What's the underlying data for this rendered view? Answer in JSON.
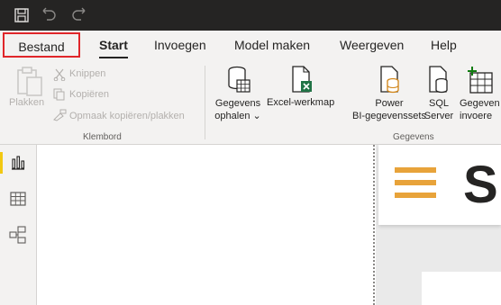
{
  "titlebar": {
    "icons": [
      "save-icon",
      "undo-icon",
      "redo-icon"
    ],
    "bg_color": "#252423"
  },
  "menu": {
    "tabs": [
      {
        "label": "Bestand",
        "highlighted": true
      },
      {
        "label": "Start",
        "active": true
      },
      {
        "label": "Invoegen"
      },
      {
        "label": "Model maken"
      },
      {
        "label": "Weergeven"
      },
      {
        "label": "Help"
      }
    ],
    "highlight_color": "#e0262a"
  },
  "ribbon": {
    "klembord": {
      "label": "Klembord",
      "plakken": "Plakken",
      "knippen": "Knippen",
      "kopieren": "Kopiëren",
      "opmaak": "Opmaak kopiëren/plakken"
    },
    "gegevens": {
      "label": "Gegevens",
      "ophalen_line1": "Gegevens",
      "ophalen_line2": "ophalen",
      "excel": "Excel-werkmap",
      "pbi_line1": "Power",
      "pbi_line2": "BI-gegevenssets",
      "sql_line1": "SQL",
      "sql_line2": "Server",
      "invoeren_line1": "Gegeven",
      "invoeren_line2": "invoere"
    }
  },
  "rail": {
    "items": [
      "report-view-icon",
      "data-view-icon",
      "model-view-icon"
    ],
    "accent": "#f2c811"
  },
  "canvas": {
    "report_title_partial": "S",
    "hamburger_color": "#e8a33a"
  }
}
